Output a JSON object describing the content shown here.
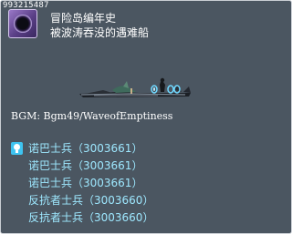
{
  "tooltip": {
    "map_id": "993215487",
    "title": "冒险岛编年史",
    "subtitle": "被波涛吞没的遇难船",
    "bgm": "BGM: Bgm49/WaveofEmptiness"
  },
  "icons": {
    "map_icon": "portal-vortex-icon",
    "npc_icon": "npc-bulb-icon"
  },
  "npcs": [
    {
      "label": "诺巴士兵（3003661）"
    },
    {
      "label": "诺巴士兵（3003661）"
    },
    {
      "label": "诺巴士兵（3003661）"
    },
    {
      "label": "反抗者士兵（3003660）"
    },
    {
      "label": "反抗者士兵（3003660）"
    }
  ],
  "colors": {
    "panel_bg": "#4b5661",
    "npc_text": "#9ee8ff",
    "npc_icon": "#3ec3f0"
  }
}
